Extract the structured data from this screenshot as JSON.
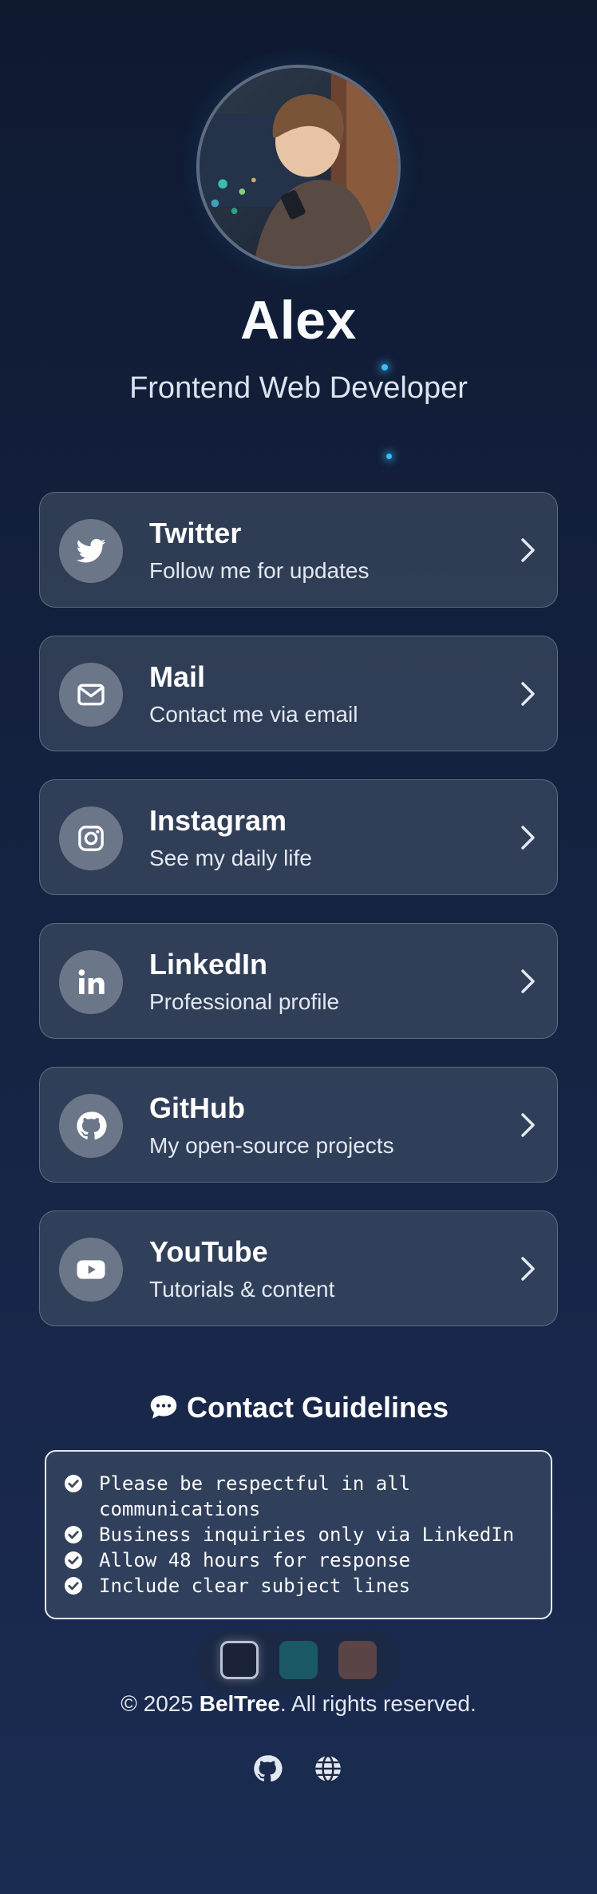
{
  "profile": {
    "name": "Alex",
    "title": "Frontend Web Developer"
  },
  "links": [
    {
      "title": "Twitter",
      "description": "Follow me for updates",
      "icon": "twitter-icon"
    },
    {
      "title": "Mail",
      "description": "Contact me via email",
      "icon": "mail-icon"
    },
    {
      "title": "Instagram",
      "description": "See my daily life",
      "icon": "instagram-icon"
    },
    {
      "title": "LinkedIn",
      "description": "Professional profile",
      "icon": "linkedin-icon"
    },
    {
      "title": "GitHub",
      "description": "My open-source projects",
      "icon": "github-icon"
    },
    {
      "title": "YouTube",
      "description": "Tutorials & content",
      "icon": "youtube-icon"
    }
  ],
  "guidelines": {
    "title": "Contact Guidelines",
    "items": [
      "Please be respectful in all communications",
      "Business inquiries only via LinkedIn",
      "Allow 48 hours for response",
      "Include clear subject lines"
    ]
  },
  "themes": {
    "swatches": [
      "#1a2338",
      "#1b5865",
      "#5a4446"
    ],
    "selected_index": 0
  },
  "footer": {
    "copyright_prefix": "© 2025 ",
    "brand": "BelTree",
    "copyright_suffix": ". All rights reserved."
  },
  "colors": {
    "accent": "#38bdf8",
    "card_bg": "#3b475c",
    "icon_circle": "#6b7689"
  }
}
